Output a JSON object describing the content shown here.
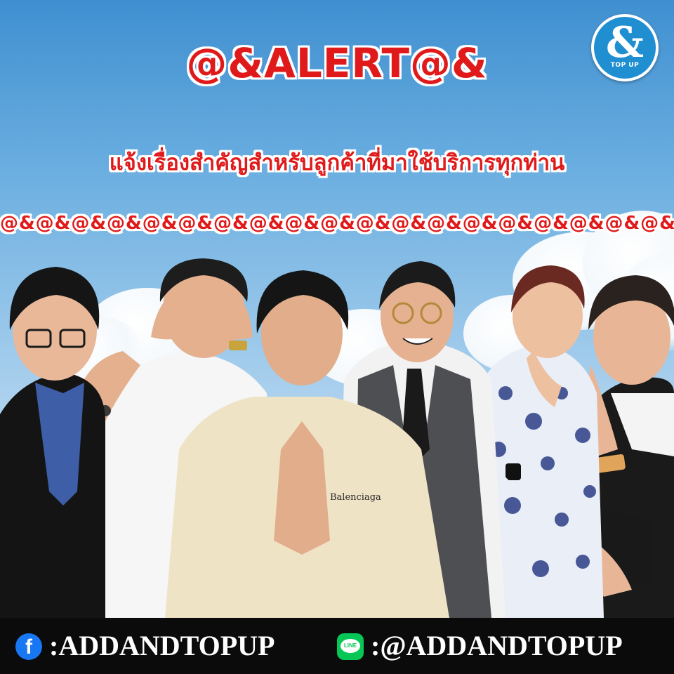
{
  "poster": {
    "title": "@&ALERT@&",
    "subtitle": "แจ้งเรื่องสำคัญสำหรับลูกค้าที่มาใช้บริการทุกท่าน",
    "divider": "@&@&@&@&@&@&@&@&@&@&@&@&@&@&@&@&@&@&@&@&"
  },
  "logo": {
    "symbol": "&",
    "text": "TOP UP"
  },
  "people": [
    {
      "name": "man-glasses-suit",
      "outfit": "black suit, blue shirt"
    },
    {
      "name": "man-covering-eyes",
      "outfit": "white shirt, tattoo"
    },
    {
      "name": "young-man-wai",
      "outfit": "cream t-shirt",
      "shirt_print": "Balenciaga"
    },
    {
      "name": "man-round-glasses",
      "outfit": "grey vest, white shirt, black tie"
    },
    {
      "name": "man-patterned-shirt",
      "outfit": "blue and white patterned shirt"
    },
    {
      "name": "man-chin-on-hand",
      "outfit": "maid costume with phone"
    }
  ],
  "footer": {
    "facebook": {
      "icon": "facebook-icon",
      "glyph": "f",
      "handle": ":ADDANDTOPUP"
    },
    "line": {
      "icon": "line-icon",
      "glyph": "LINE",
      "handle": ":@ADDANDTOPUP"
    }
  },
  "colors": {
    "headline_red": "#e01a1a",
    "sky_top": "#3f8fd0",
    "footer_bg": "#0b0b0b",
    "facebook_blue": "#1877f2",
    "line_green": "#06c755"
  }
}
